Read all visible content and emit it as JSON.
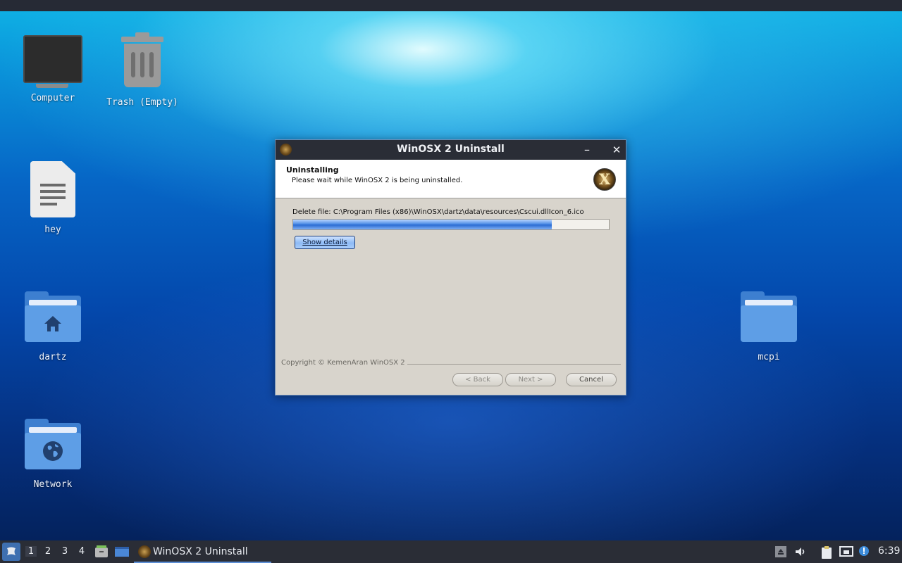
{
  "desktop": {
    "icons": [
      {
        "label": "Computer",
        "icon": "computer-icon"
      },
      {
        "label": "Trash (Empty)",
        "icon": "trash-icon"
      },
      {
        "label": "hey",
        "icon": "text-file-icon"
      },
      {
        "label": "dartz",
        "icon": "home-folder-icon"
      },
      {
        "label": "mcpi",
        "icon": "folder-icon"
      },
      {
        "label": "Network",
        "icon": "network-folder-icon"
      }
    ]
  },
  "dialog": {
    "title": "WinOSX 2 Uninstall",
    "minimize": "–",
    "close": "✕",
    "header_title": "Uninstalling",
    "header_subtitle": "Please wait while WinOSX 2 is being uninstalled.",
    "logo_letter": "X",
    "status": "Delete file: C:\\Program Files (x86)\\WinOSX\\dartz\\data\\resources\\Cscui.dllIcon_6.ico",
    "progress_fraction": 0.82,
    "show_details": "Show details",
    "copyright": "Copyright © KemenAran WinOSX 2",
    "buttons": {
      "back": "< Back",
      "next": "Next >",
      "cancel": "Cancel"
    }
  },
  "taskbar": {
    "workspaces": [
      "1",
      "2",
      "3",
      "4"
    ],
    "active_workspace": "1",
    "task_label": "WinOSX 2 Uninstall",
    "clock": "6:39"
  },
  "colors": {
    "titlebar": "#2a2d36",
    "dialog_bg": "#d8d4cc",
    "progress_fill": "#2a6bd2",
    "folder": "#5e9ee6"
  }
}
